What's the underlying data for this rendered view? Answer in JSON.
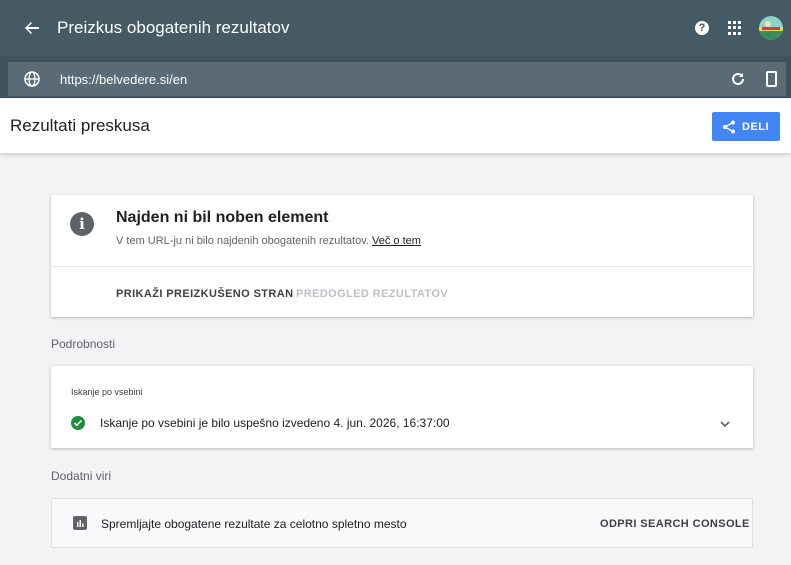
{
  "topbar": {
    "title": "Preizkus obogatenih rezultatov",
    "back_icon": "arrow-back-icon",
    "help_icon": "help-icon",
    "help_glyph": "?",
    "apps_icon": "apps-grid-icon",
    "avatar_icon": "avatar-icon"
  },
  "urlbar": {
    "url": "https://belvedere.si/en",
    "globe_icon": "globe-icon",
    "refresh_icon": "refresh-icon",
    "device_icon": "smartphone-icon"
  },
  "header": {
    "title": "Rezultati preskusa",
    "share_label": "DELI",
    "share_icon": "share-icon",
    "accent": "#4285f4"
  },
  "result_card": {
    "title": "Najden ni bil noben element",
    "subtitle": "V tem URL-ju ni bilo najdenih obogatenih rezultatov.",
    "link": "Več o tem",
    "info_icon": "info-icon",
    "info_glyph": "i",
    "action_primary": "PRIKAŽI PREIZKUŠENO STRAN",
    "action_secondary": "PREDOGLED REZULTATOV"
  },
  "details": {
    "section_label": "Podrobnosti",
    "card_label": "Iskanje po vsebini",
    "status_text": "Iskanje po vsebini je bilo uspešno izvedeno 4. jun. 2026, 16:37:00",
    "status_icon": "check-circle-icon",
    "expand_icon": "chevron-down-icon",
    "status_color": "#1e8e3e"
  },
  "resources": {
    "section_label": "Dodatni viri",
    "text": "Spremljajte obogatene rezultate za celotno spletno mesto",
    "action": "ODPRI SEARCH CONSOLE",
    "icon": "bar-chart-icon"
  }
}
